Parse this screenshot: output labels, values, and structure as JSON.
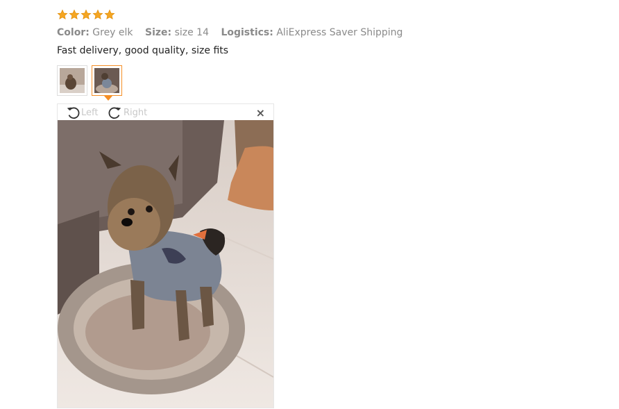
{
  "review": {
    "rating": 5,
    "rating_max": 5,
    "star_color": "#f5a623",
    "color_label": "Color:",
    "color_value": "Grey elk",
    "size_label": "Size:",
    "size_value": "size 14",
    "logistics_label": "Logistics:",
    "logistics_value": "AliExpress Saver Shipping",
    "text": "Fast delivery, good quality, size fits"
  },
  "thumbnails": [
    {
      "icon": "photo-thumbnail-icon",
      "active": false
    },
    {
      "icon": "photo-thumbnail-icon",
      "active": true
    }
  ],
  "viewer": {
    "rotate_left_label": "Left",
    "rotate_right_label": "Right",
    "rotate_left_icon": "rotate-left-icon",
    "rotate_right_icon": "rotate-right-icon",
    "close_icon": "close-icon",
    "close_glyph": "×",
    "accent_color": "#f58e25"
  }
}
